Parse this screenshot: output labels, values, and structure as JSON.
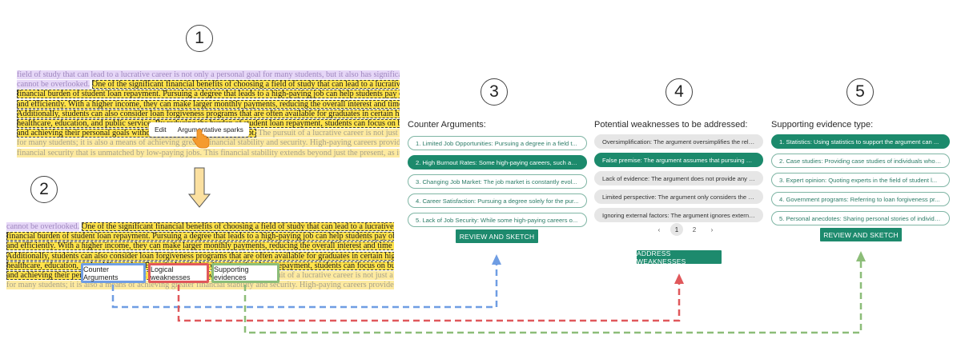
{
  "steps": [
    "1",
    "2",
    "3",
    "4",
    "5"
  ],
  "essay_top": {
    "lines": [
      [
        {
          "t": "field of study that can lead to a lucrative career is not only a personal goal for many students, but it also has significant financial benefits that",
          "c": "p"
        }
      ],
      [
        {
          "t": "cannot be overlooked.",
          "c": "p"
        },
        {
          "t": " ",
          "c": ""
        },
        {
          "t": "One of the significant financial benefits of choosing a field of study that can lead to a lucrative career is the reduced",
          "c": "y"
        }
      ],
      [
        {
          "t": "financial burden of student loan repayment. Pursuing a degree that leads to a high-paying job can help students pay off their student loans quickly",
          "c": "y"
        }
      ],
      [
        {
          "t": "and efficiently. With a higher income, they can make larger monthly payments, reducing the overall interest and time spent repaying their loans.",
          "c": "y"
        }
      ],
      [
        {
          "t": "Additionally, students can also consider loan forgiveness programs that are often available for graduates in certain high-paying fields such as",
          "c": "y"
        }
      ],
      [
        {
          "t": "healthcare, education, and public service. By reducing the burden of student loan repayment, students can focus on building their careers",
          "c": "y"
        }
      ],
      [
        {
          "t": "and achieving their personal goals without being weighed down by debt.",
          "c": "y"
        },
        {
          "t": " The pursuit of a lucrative career is not just a personal goal",
          "c": "f"
        }
      ],
      [
        {
          "t": "for many students; it is also a means of achieving greater financial stability and security. High-paying careers provide students with a sense of",
          "c": "f"
        }
      ],
      [
        {
          "t": "financial security that is unmatched by low-paying jobs. This financial stability extends beyond just the present, as it allows students to plan for",
          "c": "f"
        }
      ]
    ]
  },
  "popup": {
    "edit": "Edit",
    "sparks": "Argumentative sparks"
  },
  "essay_bottom": {
    "lines": [
      [
        {
          "t": "cannot be overlooked.",
          "c": "p"
        },
        {
          "t": " ",
          "c": ""
        },
        {
          "t": "One of the significant financial benefits of choosing a field of study that can lead to a lucrative career is the reduced",
          "c": "y"
        }
      ],
      [
        {
          "t": "financial burden of student loan repayment. Pursuing a degree that leads to a high-paying job can help students pay off their student loans quickly",
          "c": "y"
        }
      ],
      [
        {
          "t": "and efficiently. With a higher income, they can make larger monthly payments, reducing the overall interest and time spent repaying their loans.",
          "c": "y"
        }
      ],
      [
        {
          "t": "Additionally, students can also consider loan forgiveness programs that are often available for graduates in certain high-paying fields such as",
          "c": "y"
        }
      ],
      [
        {
          "t": "healthcare, education, and public service. By reducing the burden of student loan repayment, students can focus on building their careers",
          "c": "y"
        }
      ],
      [
        {
          "t": "and achieving their personal goals without being weighed down by debt.",
          "c": "y"
        },
        {
          "t": " The pursuit of a lucrative career is not just a personal goal",
          "c": "f"
        }
      ],
      [
        {
          "t": "for many students; it is also a means of achieving greater financial stability and security. High-paying careers provide students with a sense of",
          "c": "f"
        }
      ]
    ]
  },
  "tags": {
    "counter": "Counter Arguments",
    "logical": "Logical weaknesses",
    "supporting": "Supporting evidences"
  },
  "panel3": {
    "title": "Counter Arguments:",
    "items": [
      "1. Limited Job Opportunities: Pursuing a degree in a field t...",
      "2. High Burnout Rates: Some high-paying careers, such as ...",
      "3. Changing Job Market: The job market is constantly evol...",
      "4. Career Satisfaction: Pursuing a degree solely for the pur...",
      "5. Lack of Job Security: While some high-paying careers o..."
    ],
    "active_index": 1,
    "button": "REVIEW AND SKETCH"
  },
  "panel4": {
    "title": "Potential weaknesses to be addressed:",
    "items": [
      "Oversimplification: The argument oversimplifies the relatio...",
      "False premise: The argument assumes that pursuing a degr...",
      "Lack of evidence: The argument does not provide any evid...",
      "Limited perspective: The argument only considers the fina...",
      "Ignoring external factors: The argument ignores external fa..."
    ],
    "active_index": 1,
    "pager": {
      "prev": "‹",
      "pages": [
        "1",
        "2"
      ],
      "current": "1",
      "next": "›"
    },
    "button": "ADDRESS WEAKNESSES"
  },
  "panel5": {
    "title": "Supporting evidence type:",
    "items": [
      "1. Statistics: Using statistics to support the argument can ...",
      "2. Case studies: Providing case studies of individuals who ...",
      "3. Expert opinion: Quoting experts in the field of student l...",
      "4. Government programs: Referring to loan forgiveness pr...",
      "5. Personal anecdotes: Sharing personal stories of individu..."
    ],
    "active_index": 0,
    "button": "REVIEW AND SKETCH"
  },
  "colors": {
    "blue": "#6f9de3",
    "red": "#e0585b",
    "green": "#8cbd78",
    "teal": "#1c8a6c",
    "purple_highlight": "#e6d7f7",
    "yellow_highlight": "#ffe24a",
    "arrow_fill": "#fbe0a0"
  },
  "icons": [
    "pointer-hand-icon",
    "down-arrow-icon",
    "up-arrow-icon"
  ]
}
